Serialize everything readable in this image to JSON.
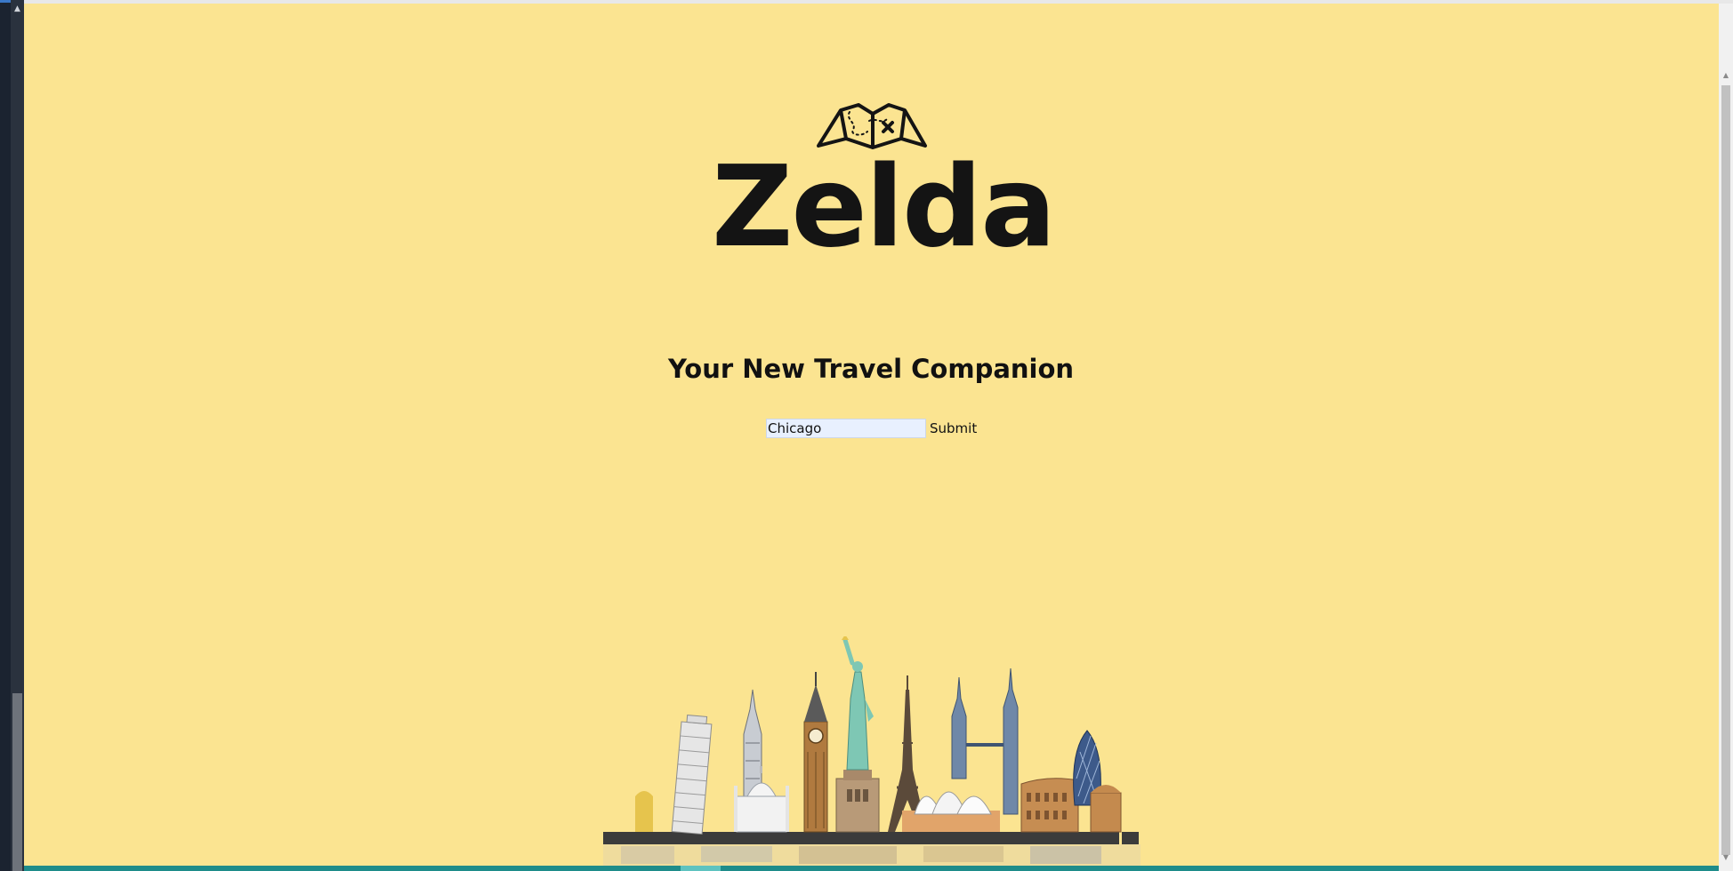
{
  "app": {
    "brand_name": "Zelda",
    "tagline": "Your New Travel Companion",
    "logo_icon": "treasure-map-icon"
  },
  "search": {
    "city_value": "Chicago",
    "submit_label": "Submit"
  },
  "illustration": {
    "name": "world-landmarks-skyline"
  },
  "colors": {
    "page_background": "#fbe491",
    "text": "#111111",
    "input_background": "#e8f0fe",
    "bottom_bar": "#1e8c8a"
  }
}
